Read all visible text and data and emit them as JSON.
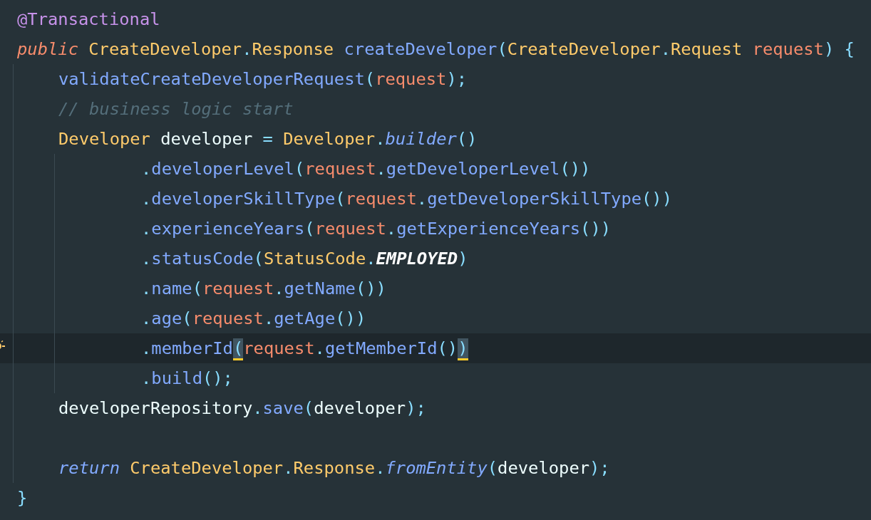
{
  "lines": [
    {
      "tokens": [
        {
          "t": "@Transactional",
          "kind": "annotation"
        }
      ]
    },
    {
      "tokens": [
        {
          "t": "public ",
          "kind": "modifier"
        },
        {
          "t": "CreateDeveloper",
          "kind": "type"
        },
        {
          "t": ".",
          "kind": "punct"
        },
        {
          "t": "Response ",
          "kind": "type"
        },
        {
          "t": "createDeveloper",
          "kind": "method"
        },
        {
          "t": "(",
          "kind": "punct"
        },
        {
          "t": "CreateDeveloper",
          "kind": "type"
        },
        {
          "t": ".",
          "kind": "punct"
        },
        {
          "t": "Request ",
          "kind": "type"
        },
        {
          "t": "request",
          "kind": "param"
        },
        {
          "t": ") {",
          "kind": "punct"
        }
      ],
      "children": [
        {
          "tokens": [
            {
              "t": "validateCreateDeveloperRequest",
              "kind": "method"
            },
            {
              "t": "(",
              "kind": "punct"
            },
            {
              "t": "request",
              "kind": "param"
            },
            {
              "t": ");",
              "kind": "punct"
            }
          ]
        },
        {
          "tokens": [
            {
              "t": "// business logic start",
              "kind": "comment"
            }
          ]
        },
        {
          "tokens": [
            {
              "t": "Developer ",
              "kind": "type"
            },
            {
              "t": "developer ",
              "kind": "variable"
            },
            {
              "t": "= ",
              "kind": "punct"
            },
            {
              "t": "Developer",
              "kind": "type"
            },
            {
              "t": ".",
              "kind": "punct"
            },
            {
              "t": "builder",
              "kind": "static"
            },
            {
              "t": "()",
              "kind": "punct"
            }
          ],
          "children": [
            {
              "tokens": [
                {
                  "t": ".",
                  "kind": "punct"
                },
                {
                  "t": "developerLevel",
                  "kind": "method"
                },
                {
                  "t": "(",
                  "kind": "punct"
                },
                {
                  "t": "request",
                  "kind": "param"
                },
                {
                  "t": ".",
                  "kind": "punct"
                },
                {
                  "t": "getDeveloperLevel",
                  "kind": "method"
                },
                {
                  "t": "())",
                  "kind": "punct"
                }
              ]
            },
            {
              "tokens": [
                {
                  "t": ".",
                  "kind": "punct"
                },
                {
                  "t": "developerSkillType",
                  "kind": "method"
                },
                {
                  "t": "(",
                  "kind": "punct"
                },
                {
                  "t": "request",
                  "kind": "param"
                },
                {
                  "t": ".",
                  "kind": "punct"
                },
                {
                  "t": "getDeveloperSkillType",
                  "kind": "method"
                },
                {
                  "t": "())",
                  "kind": "punct"
                }
              ]
            },
            {
              "tokens": [
                {
                  "t": ".",
                  "kind": "punct"
                },
                {
                  "t": "experienceYears",
                  "kind": "method"
                },
                {
                  "t": "(",
                  "kind": "punct"
                },
                {
                  "t": "request",
                  "kind": "param"
                },
                {
                  "t": ".",
                  "kind": "punct"
                },
                {
                  "t": "getExperienceYears",
                  "kind": "method"
                },
                {
                  "t": "())",
                  "kind": "punct"
                }
              ]
            },
            {
              "tokens": [
                {
                  "t": ".",
                  "kind": "punct"
                },
                {
                  "t": "statusCode",
                  "kind": "method"
                },
                {
                  "t": "(",
                  "kind": "punct"
                },
                {
                  "t": "StatusCode",
                  "kind": "type"
                },
                {
                  "t": ".",
                  "kind": "punct"
                },
                {
                  "t": "EMPLOYED",
                  "kind": "constant"
                },
                {
                  "t": ")",
                  "kind": "punct"
                }
              ]
            },
            {
              "tokens": [
                {
                  "t": ".",
                  "kind": "punct"
                },
                {
                  "t": "name",
                  "kind": "method"
                },
                {
                  "t": "(",
                  "kind": "punct"
                },
                {
                  "t": "request",
                  "kind": "param"
                },
                {
                  "t": ".",
                  "kind": "punct"
                },
                {
                  "t": "getName",
                  "kind": "method"
                },
                {
                  "t": "())",
                  "kind": "punct"
                }
              ]
            },
            {
              "tokens": [
                {
                  "t": ".",
                  "kind": "punct"
                },
                {
                  "t": "age",
                  "kind": "method"
                },
                {
                  "t": "(",
                  "kind": "punct"
                },
                {
                  "t": "request",
                  "kind": "param"
                },
                {
                  "t": ".",
                  "kind": "punct"
                },
                {
                  "t": "getAge",
                  "kind": "method"
                },
                {
                  "t": "())",
                  "kind": "punct"
                }
              ]
            },
            {
              "current": true,
              "tokens": [
                {
                  "t": ".",
                  "kind": "punct"
                },
                {
                  "t": "memberId",
                  "kind": "method"
                },
                {
                  "t": "(",
                  "kind": "punct",
                  "matched": true
                },
                {
                  "t": "request",
                  "kind": "param"
                },
                {
                  "t": ".",
                  "kind": "punct"
                },
                {
                  "t": "getMemberId",
                  "kind": "method"
                },
                {
                  "t": "()",
                  "kind": "punct"
                },
                {
                  "t": ")",
                  "kind": "punct",
                  "matched": true
                }
              ]
            },
            {
              "tokens": [
                {
                  "t": ".",
                  "kind": "punct"
                },
                {
                  "t": "build",
                  "kind": "method"
                },
                {
                  "t": "();",
                  "kind": "punct"
                }
              ]
            }
          ]
        },
        {
          "tokens": [
            {
              "t": "developerRepository",
              "kind": "variable"
            },
            {
              "t": ".",
              "kind": "punct"
            },
            {
              "t": "save",
              "kind": "method"
            },
            {
              "t": "(",
              "kind": "punct"
            },
            {
              "t": "developer",
              "kind": "variable"
            },
            {
              "t": ");",
              "kind": "punct"
            }
          ]
        },
        {
          "kind": "blank"
        },
        {
          "tokens": [
            {
              "t": "return ",
              "kind": "control"
            },
            {
              "t": "CreateDeveloper",
              "kind": "type"
            },
            {
              "t": ".",
              "kind": "punct"
            },
            {
              "t": "Response",
              "kind": "type"
            },
            {
              "t": ".",
              "kind": "punct"
            },
            {
              "t": "fromEntity",
              "kind": "static"
            },
            {
              "t": "(",
              "kind": "punct"
            },
            {
              "t": "developer",
              "kind": "variable"
            },
            {
              "t": ");",
              "kind": "punct"
            }
          ]
        }
      ]
    },
    {
      "tokens": [
        {
          "t": "}",
          "kind": "punct"
        }
      ]
    }
  ]
}
